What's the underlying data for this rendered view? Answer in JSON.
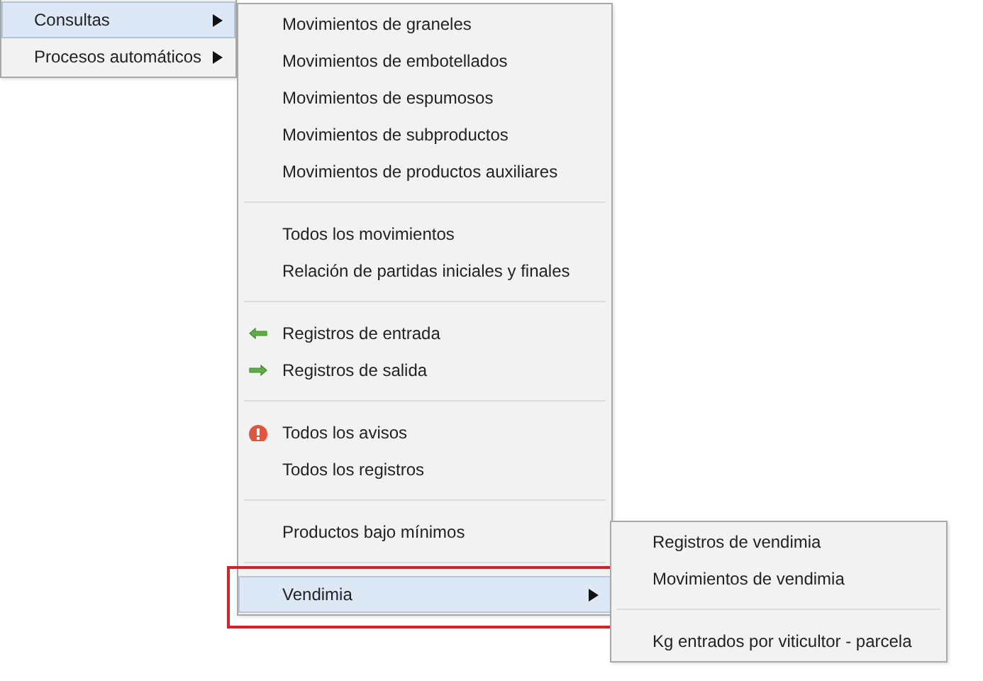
{
  "menus": [
    {
      "items": [
        {
          "kind": "plain",
          "label": "Consultas",
          "selected": true,
          "submenu": true,
          "annotated": false
        },
        {
          "kind": "plain",
          "label": "Procesos automáticos",
          "selected": false,
          "submenu": true,
          "annotated": false
        }
      ]
    },
    {
      "items": [
        {
          "kind": "plain",
          "label": "Movimientos de graneles",
          "selected": false,
          "submenu": false,
          "annotated": false
        },
        {
          "kind": "plain",
          "label": "Movimientos de embotellados",
          "selected": false,
          "submenu": false,
          "annotated": false
        },
        {
          "kind": "plain",
          "label": "Movimientos de espumosos",
          "selected": false,
          "submenu": false,
          "annotated": false
        },
        {
          "kind": "plain",
          "label": "Movimientos de subproductos",
          "selected": false,
          "submenu": false,
          "annotated": false
        },
        {
          "kind": "plain",
          "label": "Movimientos de productos auxiliares",
          "selected": false,
          "submenu": false,
          "annotated": false
        },
        {
          "kind": "separator"
        },
        {
          "kind": "plain",
          "label": "Todos los movimientos",
          "selected": false,
          "submenu": false,
          "annotated": false
        },
        {
          "kind": "plain",
          "label": "Relación de partidas iniciales y finales",
          "selected": false,
          "submenu": false,
          "annotated": false
        },
        {
          "kind": "separator"
        },
        {
          "kind": "entry",
          "label": "Registros de entrada",
          "selected": false,
          "submenu": false,
          "annotated": false
        },
        {
          "kind": "exit",
          "label": "Registros de salida",
          "selected": false,
          "submenu": false,
          "annotated": false
        },
        {
          "kind": "separator"
        },
        {
          "kind": "alert",
          "label": "Todos los avisos",
          "selected": false,
          "submenu": false,
          "annotated": false
        },
        {
          "kind": "plain",
          "label": "Todos los registros",
          "selected": false,
          "submenu": false,
          "annotated": false
        },
        {
          "kind": "separator"
        },
        {
          "kind": "plain",
          "label": "Productos bajo mínimos",
          "selected": false,
          "submenu": false,
          "annotated": false
        },
        {
          "kind": "separator"
        },
        {
          "kind": "plain",
          "label": "Vendimia",
          "selected": true,
          "submenu": true,
          "annotated": true
        }
      ]
    },
    {
      "items": [
        {
          "kind": "plain",
          "label": "Registros de vendimia",
          "selected": false,
          "submenu": false,
          "annotated": false
        },
        {
          "kind": "plain",
          "label": "Movimientos de vendimia",
          "selected": false,
          "submenu": false,
          "annotated": false
        },
        {
          "kind": "separator"
        },
        {
          "kind": "plain",
          "label": "Kg entrados por viticultor - parcela",
          "selected": false,
          "submenu": false,
          "annotated": false
        }
      ]
    }
  ]
}
